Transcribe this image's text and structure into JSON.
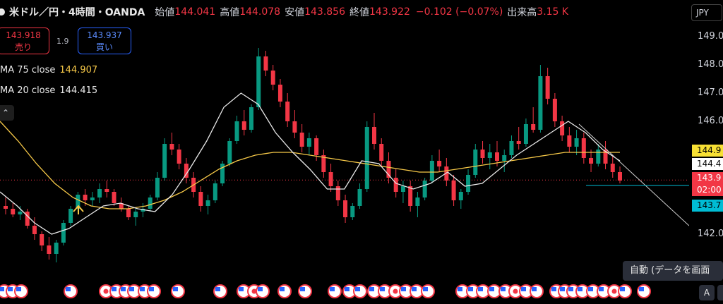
{
  "header": {
    "symbol": "米ドル／円・4時間・OANDA",
    "open_label": "始値",
    "open": "144.041",
    "high_label": "高値",
    "high": "144.078",
    "low_label": "安値",
    "low": "143.856",
    "close_label": "終値",
    "close": "143.922",
    "change": "−0.102 (−0.07%)",
    "volume_label": "出来高",
    "volume": "3.15 K"
  },
  "quote": {
    "sell_price": "143.918",
    "sell_label": "売り",
    "spread": "1.9",
    "buy_price": "143.937",
    "buy_label": "買い"
  },
  "indicators": [
    {
      "label": "MA 75 close",
      "value": "144.907",
      "color": "#f7c948"
    },
    {
      "label": "MA 20 close",
      "value": "144.415",
      "color": "#e8e8e8"
    }
  ],
  "collapse_icon": "chevron-up-icon",
  "price_axis": {
    "currency": "JPY",
    "ticks": [
      "149.0",
      "148.0",
      "147.0",
      "146.0",
      "142.0"
    ],
    "badges": [
      {
        "text": "144.9",
        "bg": "#f7e034",
        "fg": "#000000"
      },
      {
        "text": "144.4",
        "bg": "#ffffff",
        "fg": "#000000"
      },
      {
        "text": "143.9",
        "bg": "#f23645",
        "fg": "#ffffff"
      },
      {
        "text": "02:00",
        "bg": "#f23645",
        "fg": "#ffffff"
      },
      {
        "text": "143.7",
        "bg": "#00bcd4",
        "fg": "#000000"
      }
    ]
  },
  "tooltip": "自動 (データを画面",
  "auto_button": "A",
  "colors": {
    "up": "#089981",
    "down": "#f23645",
    "ma75": "#f7c948",
    "ma20": "#e8e8e8",
    "trend": "#d0d0d0",
    "support": "#00bcd4"
  },
  "chart_data": {
    "type": "candlestick",
    "ylim": [
      141.0,
      149.5
    ],
    "price_tick_values": [
      149.0,
      148.0,
      147.0,
      146.0,
      142.0
    ],
    "candles": [
      [
        143.0,
        143.3,
        142.7,
        142.9
      ],
      [
        142.9,
        143.1,
        142.6,
        142.7
      ],
      [
        142.7,
        143.0,
        142.5,
        142.8
      ],
      [
        142.8,
        142.9,
        142.2,
        142.3
      ],
      [
        142.3,
        142.6,
        141.8,
        142.0
      ],
      [
        142.0,
        142.1,
        141.4,
        141.6
      ],
      [
        141.6,
        141.9,
        141.1,
        141.3
      ],
      [
        141.3,
        141.8,
        141.0,
        141.7
      ],
      [
        141.7,
        142.5,
        141.6,
        142.4
      ],
      [
        142.4,
        143.0,
        142.3,
        142.9
      ],
      [
        142.9,
        143.5,
        142.8,
        143.4
      ],
      [
        143.4,
        143.6,
        143.0,
        143.2
      ],
      [
        143.2,
        143.5,
        143.0,
        143.3
      ],
      [
        143.3,
        143.8,
        143.1,
        143.6
      ],
      [
        143.6,
        143.9,
        143.3,
        143.5
      ],
      [
        143.5,
        143.6,
        143.0,
        143.1
      ],
      [
        143.1,
        143.3,
        142.8,
        142.9
      ],
      [
        142.9,
        143.0,
        142.5,
        142.6
      ],
      [
        142.6,
        142.9,
        142.3,
        142.8
      ],
      [
        142.8,
        143.1,
        142.6,
        142.9
      ],
      [
        142.9,
        143.4,
        142.8,
        143.3
      ],
      [
        143.3,
        144.2,
        143.2,
        144.0
      ],
      [
        144.0,
        145.4,
        143.9,
        145.2
      ],
      [
        145.2,
        145.6,
        144.8,
        145.0
      ],
      [
        145.0,
        145.2,
        144.3,
        144.5
      ],
      [
        144.5,
        144.7,
        143.8,
        144.0
      ],
      [
        144.0,
        144.2,
        143.3,
        143.5
      ],
      [
        143.5,
        143.7,
        142.8,
        143.0
      ],
      [
        143.0,
        143.4,
        142.7,
        143.2
      ],
      [
        143.2,
        143.9,
        143.1,
        143.8
      ],
      [
        143.8,
        144.6,
        143.7,
        144.5
      ],
      [
        144.5,
        145.4,
        144.4,
        145.3
      ],
      [
        145.3,
        146.2,
        145.2,
        146.0
      ],
      [
        146.0,
        146.4,
        145.5,
        145.7
      ],
      [
        145.7,
        146.6,
        145.6,
        146.5
      ],
      [
        146.5,
        148.6,
        146.4,
        148.3
      ],
      [
        148.3,
        148.5,
        147.6,
        147.8
      ],
      [
        147.8,
        148.0,
        147.1,
        147.3
      ],
      [
        147.3,
        147.5,
        146.5,
        146.7
      ],
      [
        146.7,
        147.0,
        145.8,
        146.0
      ],
      [
        146.0,
        146.4,
        145.4,
        145.6
      ],
      [
        145.6,
        145.9,
        144.9,
        145.1
      ],
      [
        145.1,
        145.6,
        144.8,
        145.4
      ],
      [
        145.4,
        145.5,
        144.6,
        144.8
      ],
      [
        144.8,
        145.0,
        144.0,
        144.2
      ],
      [
        144.2,
        144.5,
        143.5,
        143.7
      ],
      [
        143.7,
        143.9,
        143.0,
        143.2
      ],
      [
        143.2,
        143.4,
        142.4,
        142.6
      ],
      [
        142.6,
        143.1,
        142.5,
        143.0
      ],
      [
        143.0,
        143.8,
        142.9,
        143.6
      ],
      [
        143.6,
        146.0,
        143.5,
        145.8
      ],
      [
        145.8,
        146.3,
        145.0,
        145.2
      ],
      [
        145.2,
        145.4,
        144.4,
        144.6
      ],
      [
        144.6,
        144.9,
        143.8,
        144.0
      ],
      [
        144.0,
        144.3,
        143.3,
        143.5
      ],
      [
        143.5,
        143.9,
        143.1,
        143.7
      ],
      [
        143.7,
        143.9,
        142.8,
        143.0
      ],
      [
        143.0,
        143.5,
        142.6,
        143.3
      ],
      [
        143.3,
        144.0,
        143.2,
        143.9
      ],
      [
        143.9,
        144.8,
        143.8,
        144.6
      ],
      [
        144.6,
        145.0,
        144.2,
        144.4
      ],
      [
        144.4,
        144.7,
        143.7,
        143.9
      ],
      [
        143.9,
        144.1,
        143.0,
        143.2
      ],
      [
        143.2,
        143.6,
        142.9,
        143.5
      ],
      [
        143.5,
        144.3,
        143.4,
        144.1
      ],
      [
        144.1,
        145.2,
        144.0,
        145.0
      ],
      [
        145.0,
        145.3,
        144.5,
        144.7
      ],
      [
        144.7,
        145.2,
        144.3,
        144.9
      ],
      [
        144.9,
        145.3,
        144.4,
        144.6
      ],
      [
        144.6,
        145.0,
        144.2,
        144.8
      ],
      [
        144.8,
        145.5,
        144.7,
        145.3
      ],
      [
        145.3,
        145.8,
        145.0,
        145.2
      ],
      [
        145.2,
        146.1,
        145.1,
        145.9
      ],
      [
        145.9,
        146.5,
        145.6,
        145.7
      ],
      [
        145.7,
        148.0,
        145.6,
        147.6
      ],
      [
        147.6,
        147.9,
        146.6,
        146.8
      ],
      [
        146.8,
        147.0,
        145.8,
        146.0
      ],
      [
        146.0,
        146.2,
        145.3,
        145.5
      ],
      [
        145.5,
        145.8,
        144.9,
        145.1
      ],
      [
        145.1,
        145.7,
        144.8,
        145.4
      ],
      [
        145.4,
        145.6,
        144.5,
        144.7
      ],
      [
        144.7,
        145.0,
        144.2,
        144.5
      ],
      [
        144.5,
        145.2,
        144.4,
        145.0
      ],
      [
        145.0,
        145.3,
        144.3,
        144.5
      ],
      [
        144.5,
        144.8,
        144.0,
        144.2
      ],
      [
        144.2,
        144.4,
        143.8,
        143.9
      ]
    ],
    "series": [
      {
        "name": "MA 75 close",
        "values": [
          146.0,
          145.3,
          144.5,
          143.8,
          143.3,
          143.0,
          142.9,
          142.9,
          143.0,
          143.2,
          143.5,
          143.9,
          144.3,
          144.6,
          144.8,
          144.9,
          144.9,
          144.8,
          144.7,
          144.6,
          144.5,
          144.4,
          144.3,
          144.2,
          144.2,
          144.3,
          144.4,
          144.5,
          144.6,
          144.7,
          144.8,
          144.9,
          144.9,
          144.9,
          144.9
        ]
      },
      {
        "name": "MA 20 close",
        "values": [
          143.5,
          143.0,
          142.4,
          142.0,
          142.2,
          142.6,
          143.0,
          143.1,
          142.9,
          142.8,
          143.4,
          144.3,
          145.3,
          146.5,
          147.0,
          146.6,
          145.6,
          144.9,
          144.3,
          143.6,
          143.6,
          144.6,
          144.5,
          143.8,
          143.6,
          143.8,
          144.2,
          143.7,
          143.8,
          144.3,
          144.8,
          145.2,
          145.6,
          146.0,
          145.6,
          145.0,
          144.6
        ]
      }
    ]
  }
}
